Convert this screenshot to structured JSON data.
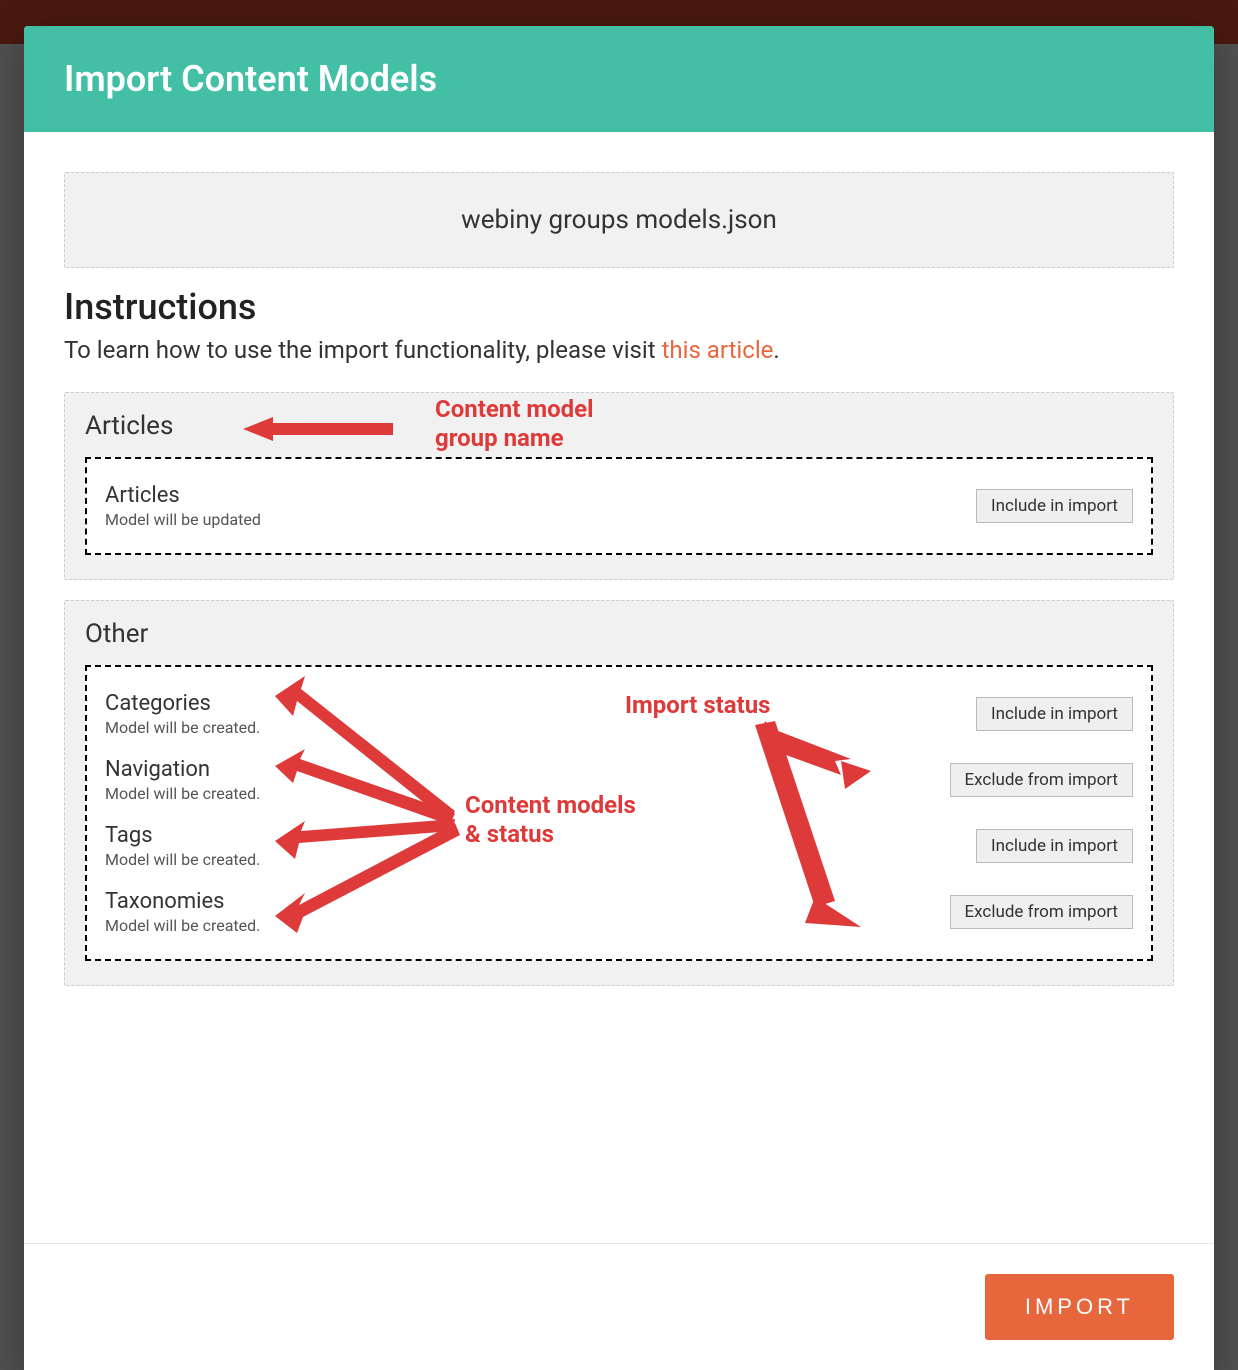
{
  "modal": {
    "title": "Import Content Models",
    "file_name": "webiny groups models.json",
    "instructions_heading": "Instructions",
    "instructions_text_prefix": "To learn how to use the import functionality, please visit ",
    "instructions_link_text": "this article",
    "instructions_text_suffix": ".",
    "import_button": "IMPORT"
  },
  "button_labels": {
    "include": "Include in import",
    "exclude": "Exclude from import"
  },
  "groups": [
    {
      "name": "Articles",
      "models": [
        {
          "name": "Articles",
          "status": "Model will be updated",
          "action": "include"
        }
      ]
    },
    {
      "name": "Other",
      "models": [
        {
          "name": "Categories",
          "status": "Model will be created.",
          "action": "include"
        },
        {
          "name": "Navigation",
          "status": "Model will be created.",
          "action": "exclude"
        },
        {
          "name": "Tags",
          "status": "Model will be created.",
          "action": "include"
        },
        {
          "name": "Taxonomies",
          "status": "Model will be created.",
          "action": "exclude"
        }
      ]
    }
  ],
  "annotations": {
    "group_name": "Content model\ngroup name",
    "models_status": "Content models\n& status",
    "import_status": "Import status"
  }
}
